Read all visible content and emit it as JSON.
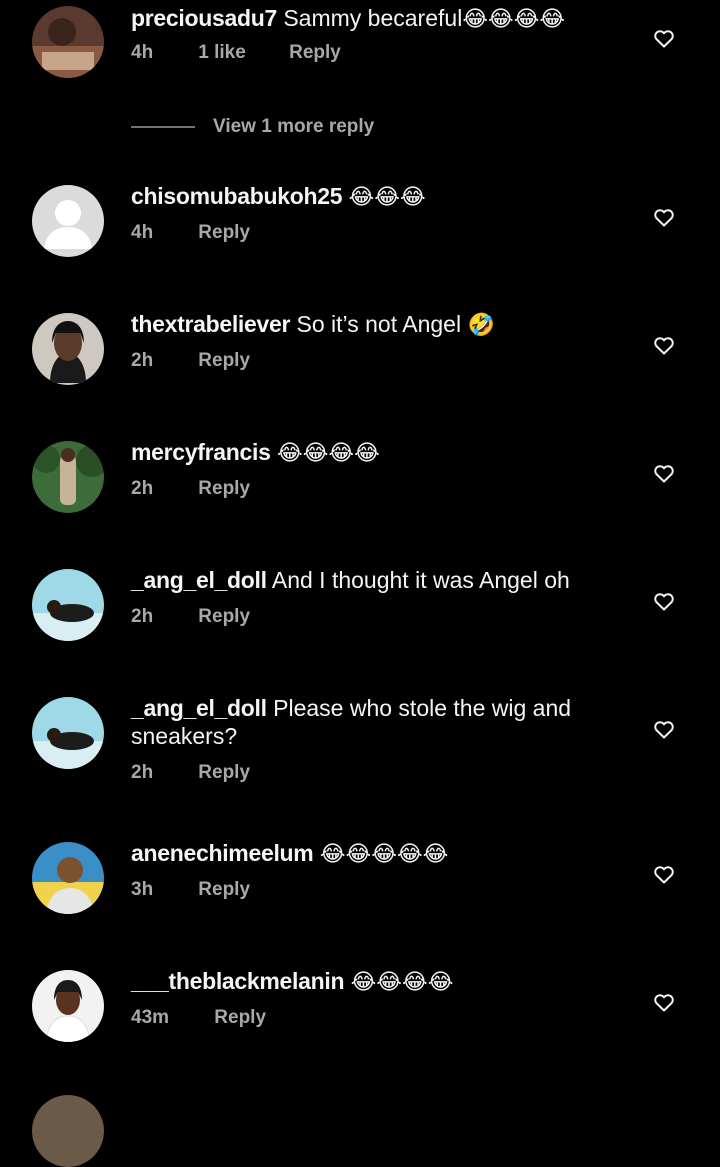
{
  "comments": [
    {
      "username": "preciousadu7",
      "text": "Sammy becareful",
      "emoji": "😂😂😂😂",
      "time": "4h",
      "likes": "1 like",
      "reply": "Reply"
    },
    {
      "username": "chisomubabukoh25",
      "text": "",
      "emoji": "😂😂😂",
      "time": "4h",
      "likes": "",
      "reply": "Reply"
    },
    {
      "username": "thextrabeliever",
      "text": "So it’s not Angel",
      "emoji": "🤣",
      "time": "2h",
      "likes": "",
      "reply": "Reply"
    },
    {
      "username": "mercyfrancis",
      "text": "",
      "emoji": "😂😂😂😂",
      "time": "2h",
      "likes": "",
      "reply": "Reply"
    },
    {
      "username": "_ang_el_doll",
      "text": "And I thought it was Angel oh",
      "emoji": "",
      "time": "2h",
      "likes": "",
      "reply": "Reply"
    },
    {
      "username": "_ang_el_doll",
      "text": "Please who stole the wig and sneakers?",
      "emoji": "",
      "time": "2h",
      "likes": "",
      "reply": "Reply"
    },
    {
      "username": "anenechimeelum",
      "text": "",
      "emoji": "😂😂😂😂😂",
      "time": "3h",
      "likes": "",
      "reply": "Reply"
    },
    {
      "username": "___theblackmelanin",
      "text": "",
      "emoji": "😂😂😂😂",
      "time": "43m",
      "likes": "",
      "reply": "Reply"
    }
  ],
  "view_more": "View 1 more reply",
  "colors": {
    "background": "#000000",
    "primary_text": "#f5f5f5",
    "secondary_text": "#a8a8a8"
  },
  "icons": {
    "like": "heart-outline-icon"
  }
}
